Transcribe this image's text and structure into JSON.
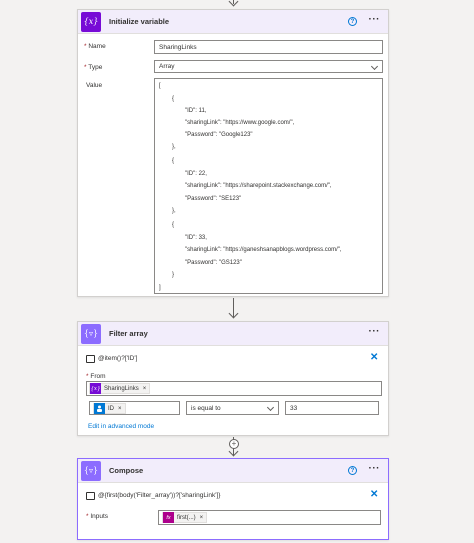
{
  "colors": {
    "variable_icon": "#770bd6",
    "filter_icon": "#8c6cff",
    "compose_icon": "#8c6cff",
    "header_bg": "#f2edfb",
    "accent": "#0078d4",
    "fx_token": "#ad008c"
  },
  "init_variable": {
    "icon_text": "{x}",
    "title": "Initialize variable",
    "help_icon_text": "?",
    "more_icon_text": "···",
    "name_label": "Name",
    "name_value": "SharingLinks",
    "type_label": "Type",
    "type_value": "Array",
    "value_label": "Value",
    "value_lines": [
      "[",
      "{",
      "\"ID\": 11,",
      "\"sharingLink\": \"https://www.google.com/\",",
      "\"Password\": \"Google123\"",
      "},",
      "{",
      "\"ID\": 22,",
      "\"sharingLink\": \"https://sharepoint.stackexchange.com/\",",
      "\"Password\": \"SE123\"",
      "},",
      "{",
      "\"ID\": 33,",
      "\"sharingLink\": \"https://ganeshsanapblogs.wordpress.com/\",",
      "\"Password\": \"GS123\"",
      "}",
      "]"
    ]
  },
  "filter_array": {
    "icon_text": "{▿}",
    "title": "Filter array",
    "more_icon_text": "···",
    "condition_text": "@item()?['ID']",
    "close_text": "✕",
    "from_label": "From",
    "from_token_icon": "{x}",
    "from_token_label": "SharingLinks",
    "token_remove": "×",
    "left_token_label": "ID",
    "operator": "is equal to",
    "right_value": "33",
    "advanced_link": "Edit in advanced mode"
  },
  "add_step": {
    "label": "+"
  },
  "compose": {
    "icon_text": "{▿}",
    "title": "Compose",
    "help_icon_text": "?",
    "more_icon_text": "···",
    "expression_text": "@{first(body('Filter_array'))?['sharingLink']}",
    "close_text": "✕",
    "inputs_label": "Inputs",
    "inputs_token_icon": "fx",
    "inputs_token_label": "first(...)",
    "token_remove": "×"
  }
}
